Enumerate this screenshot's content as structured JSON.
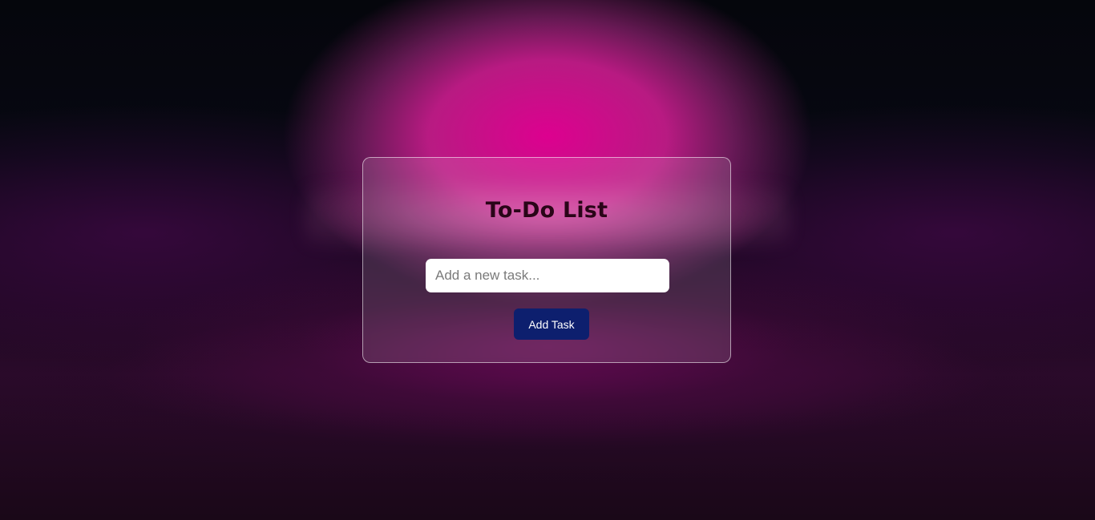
{
  "app": {
    "title": "To-Do List"
  },
  "input": {
    "placeholder": "Add a new task...",
    "value": ""
  },
  "actions": {
    "add_label": "Add Task"
  },
  "colors": {
    "button_bg": "#0d1f6e",
    "title_text": "#2a0518",
    "glow_pink": "#e80096"
  }
}
